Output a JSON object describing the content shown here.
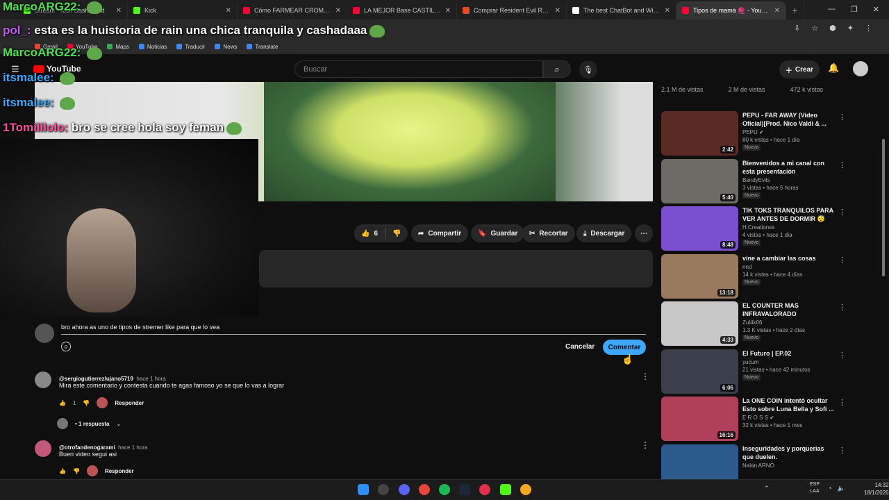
{
  "browser": {
    "tabs": [
      {
        "title": "Stream - Kick Dashboard",
        "color": "#53fc18"
      },
      {
        "title": "Kick",
        "color": "#53fc18"
      },
      {
        "title": "Cómo FARMEAR CROMOS en",
        "color": "#ff0033"
      },
      {
        "title": "LA MEJOR Base CASTILLO para",
        "color": "#ff0033"
      },
      {
        "title": "Comprar Resident Evil Requiem",
        "color": "#e34c26"
      },
      {
        "title": "The best ChatBot and Widgets",
        "color": "#ffffff"
      },
      {
        "title": "Tipos de mamá 🧶 - YouTube",
        "color": "#ff0033"
      }
    ],
    "bookmarks": [
      {
        "label": "Gmail",
        "color": "#ea4335"
      },
      {
        "label": "YouTube",
        "color": "#ff0033"
      },
      {
        "label": "Maps",
        "color": "#34a853"
      },
      {
        "label": "Noticias",
        "color": "#4285f4"
      },
      {
        "label": "Traducir",
        "color": "#4285f4"
      },
      {
        "label": "News",
        "color": "#4285f4"
      },
      {
        "label": "Translate",
        "color": "#4285f4"
      }
    ]
  },
  "youtube": {
    "logo": "YouTube",
    "search_placeholder": "Buscar",
    "create_label": "Crear",
    "actions": {
      "likes": "6",
      "share": "Compartir",
      "save": "Guardar",
      "clip": "Recortar",
      "download": "Descargar"
    },
    "composer": {
      "value": "bro ahora as uno de tipos de stremer like para que lo vea",
      "cancel": "Cancelar",
      "submit": "Comentar"
    },
    "comments": [
      {
        "author": "@sergiogutierrezlujano5719",
        "time": "hace 1 hora",
        "text": "Mira este comentario y contesta cuando te agas famoso yo se que lo vas a lograr",
        "likes": "1",
        "reply": "Responder",
        "replies": "1 respuesta"
      },
      {
        "author": "@otrofandenogarami",
        "time": "hace 1 hora",
        "text": "Buen video segui asi",
        "likes": "",
        "reply": "Responder"
      }
    ],
    "views_row": [
      "2.1 M de vistas",
      "2 M de vistas",
      "472 k vistas"
    ],
    "recommendations": [
      {
        "title": "PEPU - FAR AWAY (Video Oficial)[Prod. Nico Valdi & ...",
        "channel": "PEPU ✔",
        "meta": "80 k vistas • hace 1 día",
        "badge": "Nuevo",
        "duration": "2:42",
        "thumb": "#5a2a24"
      },
      {
        "title": "Bienvenidos a mi canal con esta presentación",
        "channel": "BendyEvils",
        "meta": "3 vistas • hace 5 horas",
        "badge": "Nuevo",
        "duration": "5:40",
        "thumb": "#6e6a66"
      },
      {
        "title": "TIK TOKS TRANQUILOS PARA VER ANTES DE DORMIR 😴",
        "channel": "H.Creationss",
        "meta": "4 vistas • hace 1 día",
        "badge": "Nuevo",
        "duration": "8:48",
        "thumb": "#7a4fd0"
      },
      {
        "title": "vine a cambiar las cosas",
        "channel": "nnd",
        "meta": "14 k vistas • hace 4 días",
        "badge": "Nuevo",
        "duration": "13:18",
        "thumb": "#9a7a5c"
      },
      {
        "title": "EL COUNTER MAS INFRAVALORADO",
        "channel": "Zul4k06",
        "meta": "1.3 K vistas • hace 2 días",
        "badge": "Nuevo",
        "duration": "4:33",
        "thumb": "#c8c8c8"
      },
      {
        "title": "El Futuro | EP.02",
        "channel": "yucum",
        "meta": "21 vistas • hace 42 minutos",
        "badge": "Nuevo",
        "duration": "6:06",
        "thumb": "#3a3f4a"
      },
      {
        "title": "La ONE COIN intentó ocultar Esto sobre Luna Bella y Sofi ...",
        "channel": "E R O S S ✔",
        "meta": "32 k vistas • hace 1 mes",
        "badge": "",
        "duration": "16:16",
        "thumb": "#b0405a"
      },
      {
        "title": "Inseguridades y porquerías que duelen.",
        "channel": "Nalan ARNO",
        "meta": "",
        "badge": "",
        "duration": "",
        "thumb": "#2d5a8c"
      }
    ]
  },
  "chat_overlay": [
    {
      "user": "MarcoARG22:",
      "msg": "",
      "color": "#4fe04f"
    },
    {
      "user": "pol_:",
      "msg": "esta es la huistoria de rain una chica tranquila y cashadaaa",
      "color": "#c85cff"
    },
    {
      "user": "MarcoARG22:",
      "msg": "",
      "color": "#4fe04f"
    },
    {
      "user": "itsmalee:",
      "msg": "",
      "color": "#3aa8ff"
    },
    {
      "user": "itsmalee:",
      "msg": "",
      "color": "#3aa8ff"
    },
    {
      "user": "1Tomililolo:",
      "msg": "bro se cree hola soy feman",
      "color": "#ff4fa0"
    }
  ],
  "taskbar": {
    "lang_top": "ESP",
    "lang_bottom": "LAA",
    "time": "14:32",
    "date": "18/1/2026"
  }
}
